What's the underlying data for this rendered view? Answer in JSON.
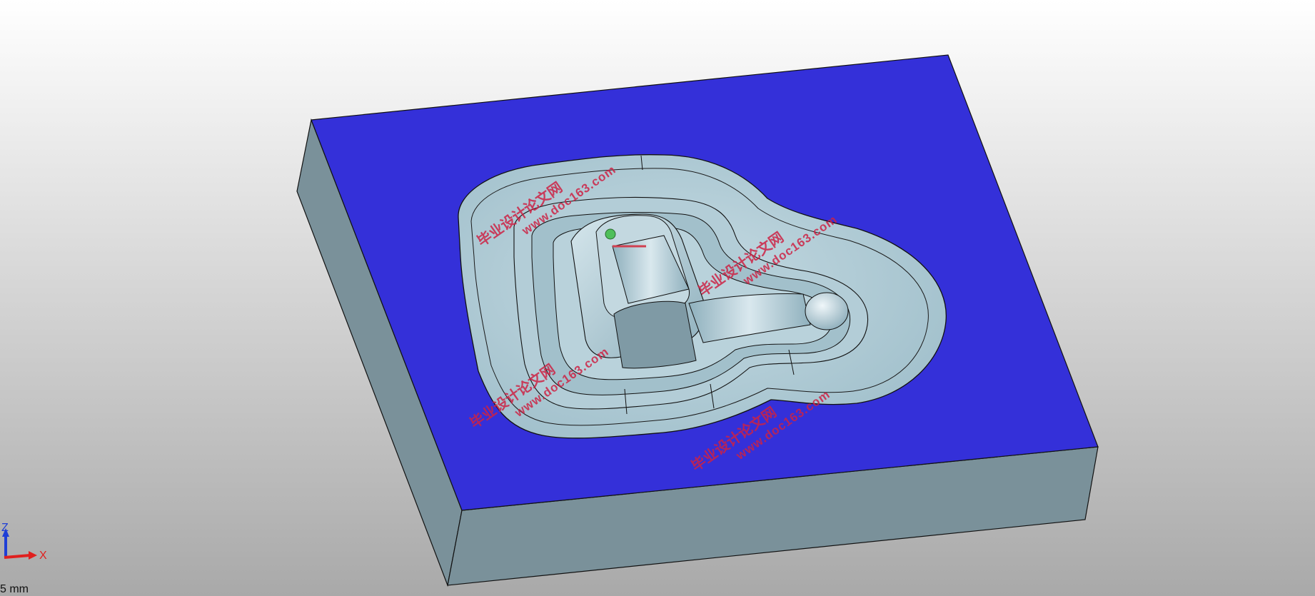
{
  "viewport": {
    "background_top": "#ffffff",
    "background_bottom": "#a9a9a9"
  },
  "model": {
    "top_face_color": "#3430d9",
    "side_face_color": "#7a919a",
    "cavity_color": "#a7c4cf",
    "edge_color": "#111111"
  },
  "watermarks": [
    {
      "url": "www.doc163.com",
      "cn": "毕业设计论文网"
    },
    {
      "url": "www.doc163.com",
      "cn": "毕业设计论文网"
    },
    {
      "url": "www.doc163.com",
      "cn": "毕业设计论文网"
    },
    {
      "url": "www.doc163.com",
      "cn": "毕业设计论文网"
    }
  ],
  "triad": {
    "z_label": "Z",
    "x_label": "X",
    "z_color": "#1f3fd6",
    "x_color": "#e0201f"
  },
  "scale": {
    "label": "5 mm"
  }
}
